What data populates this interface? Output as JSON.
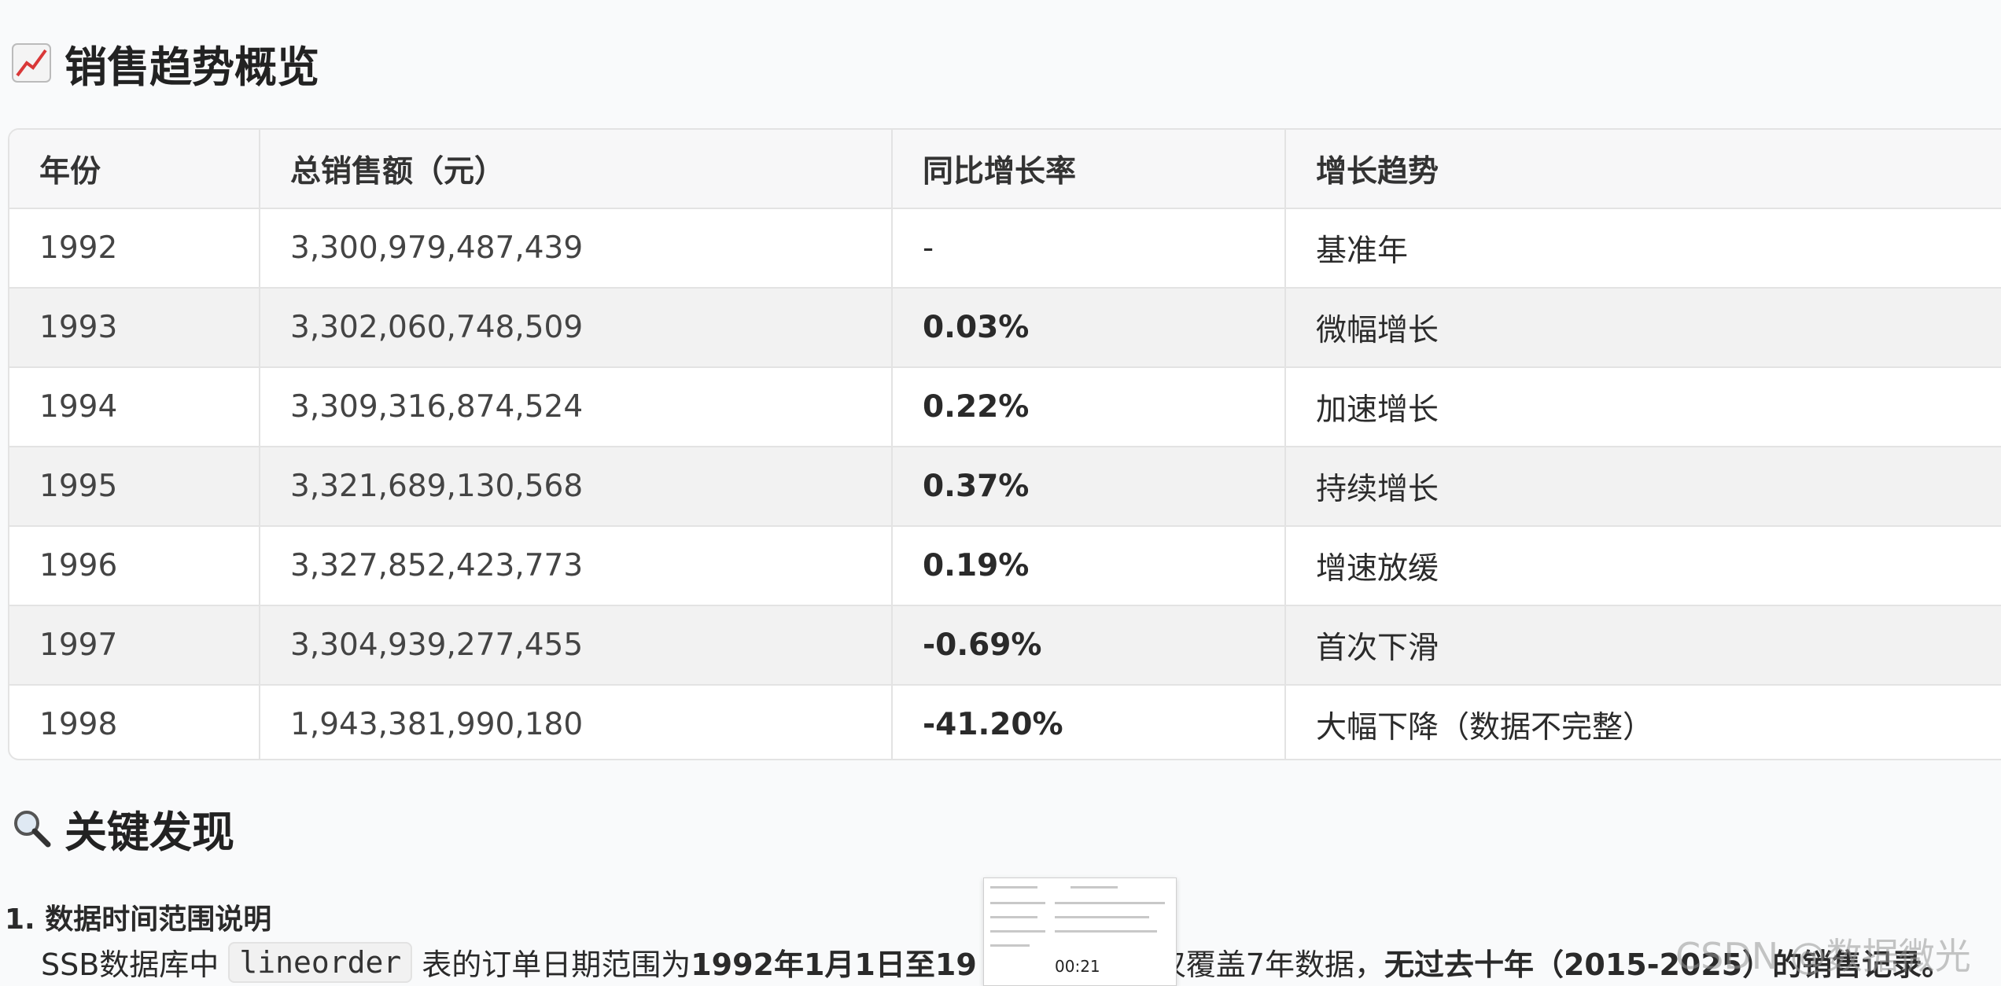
{
  "sales_section": {
    "icon": "chart-increasing-icon",
    "title": "销售趋势概览"
  },
  "table": {
    "headers": [
      "年份",
      "总销售额（元）",
      "同比增长率",
      "增长趋势"
    ],
    "rows": [
      {
        "year": "1992",
        "total": "3,300,979,487,439",
        "rate": "-",
        "trend": "基准年"
      },
      {
        "year": "1993",
        "total": "3,302,060,748,509",
        "rate": "0.03%",
        "trend": "微幅增长"
      },
      {
        "year": "1994",
        "total": "3,309,316,874,524",
        "rate": "0.22%",
        "trend": "加速增长"
      },
      {
        "year": "1995",
        "total": "3,321,689,130,568",
        "rate": "0.37%",
        "trend": "持续增长"
      },
      {
        "year": "1996",
        "total": "3,327,852,423,773",
        "rate": "0.19%",
        "trend": "增速放缓"
      },
      {
        "year": "1997",
        "total": "3,304,939,277,455",
        "rate": "-0.69%",
        "trend": "首次下滑"
      },
      {
        "year": "1998",
        "total": "1,943,381,990,180",
        "rate": "-41.20%",
        "trend": "大幅下降（数据不完整）"
      }
    ]
  },
  "findings_section": {
    "icon": "magnifier-icon",
    "title": "关键发现"
  },
  "finding_1": {
    "number": "1.",
    "heading": "数据时间范围说明",
    "text_before": "SSB数据库中",
    "code": "lineorder",
    "text_mid": "表的订单日期范围为",
    "bold_range": "1992年1月1日至19",
    "text_after": "，仅覆盖7年数据，",
    "bold_tail": "无过去十年（2015-2025）的销售记录。"
  },
  "video_thumb": {
    "time": "00:21"
  },
  "watermark": "CSDN @数据微光"
}
